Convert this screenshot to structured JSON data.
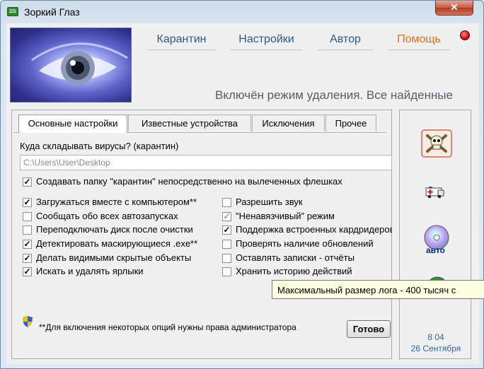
{
  "window": {
    "title": "Зоркий Глаз",
    "close_symbol": "✕"
  },
  "nav": {
    "items": [
      {
        "label": "Карантин"
      },
      {
        "label": "Настройки"
      },
      {
        "label": "Автор"
      },
      {
        "label": "Помощь"
      }
    ],
    "help_color": "#e07020"
  },
  "status_line": "Включён режим удаления. Все найденные",
  "tabs": [
    {
      "label": "Основные настройки",
      "active": true
    },
    {
      "label": "Известные устройства"
    },
    {
      "label": "Исключения"
    },
    {
      "label": "Прочее"
    }
  ],
  "quarantine": {
    "label": "Куда складывать вирусы? (карантин)",
    "value": "C:\\Users\\User\\Desktop"
  },
  "options": {
    "create_folder": {
      "label": "Создавать папку \"карантин\" непосредственно на вылеченных флешках",
      "checked": true
    },
    "left": [
      {
        "label": "Загружаться вместе с компьютером**",
        "checked": true
      },
      {
        "label": "Сообщать обо всех автозапусках",
        "checked": false
      },
      {
        "label": "Переподключать диск после очистки",
        "checked": false
      },
      {
        "label": "Детектировать маскирующиеся .exe**",
        "checked": true
      },
      {
        "label": "Делать видимыми скрытые объекты",
        "checked": true
      },
      {
        "label": "Искать и удалять ярлыки",
        "checked": true
      }
    ],
    "right": [
      {
        "label": "Разрешить звук",
        "checked": false
      },
      {
        "label": "\"Ненавязчивый\" режим",
        "checked": true,
        "disabled": true
      },
      {
        "label": "Поддержка встроенных кардридеров",
        "checked": true
      },
      {
        "label": "Проверять наличие обновлений",
        "checked": false
      },
      {
        "label": "Оставлять записки - отчёты",
        "checked": false
      },
      {
        "label": "Хранить историю действий",
        "checked": false
      }
    ]
  },
  "admin_note": "**Для включения некоторых опций нужны права администратора",
  "done_button": "Готово",
  "side": {
    "auto_label": "авто",
    "time": "8 04",
    "date": "26 Сентября"
  },
  "tooltip": "Максимальный размер лога - 400 тысяч с"
}
